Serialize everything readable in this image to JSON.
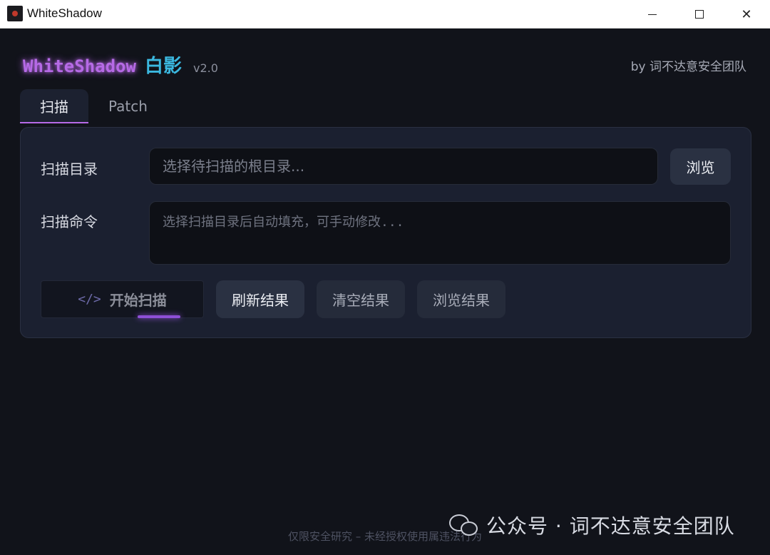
{
  "window": {
    "title": "WhiteShadow"
  },
  "header": {
    "brand_name": "WhiteShadow",
    "brand_cn": "白影",
    "version": "v2.0",
    "byline": "by 词不达意安全团队"
  },
  "tabs": [
    {
      "label": "扫描",
      "active": true
    },
    {
      "label": "Patch",
      "active": false
    }
  ],
  "scan": {
    "dir_label": "扫描目录",
    "dir_value": "",
    "dir_placeholder": "选择待扫描的根目录...",
    "browse_label": "浏览",
    "cmd_label": "扫描命令",
    "cmd_value": "",
    "cmd_placeholder": "选择扫描目录后自动填充，可手动修改...",
    "start_icon": "</>",
    "start_label": "开始扫描",
    "refresh_label": "刷新结果",
    "clear_label": "清空结果",
    "view_label": "浏览结果"
  },
  "footer": {
    "notice": "仅限安全研究 – 未经授权使用属违法行为"
  },
  "watermark": {
    "text": "公众号 · 词不达意安全团队",
    "icon": "wechat-icon"
  },
  "colors": {
    "accent_purple": "#b66ae6",
    "accent_cyan": "#3bb8e0",
    "background": "#11131a",
    "panel": "#1b2030"
  }
}
